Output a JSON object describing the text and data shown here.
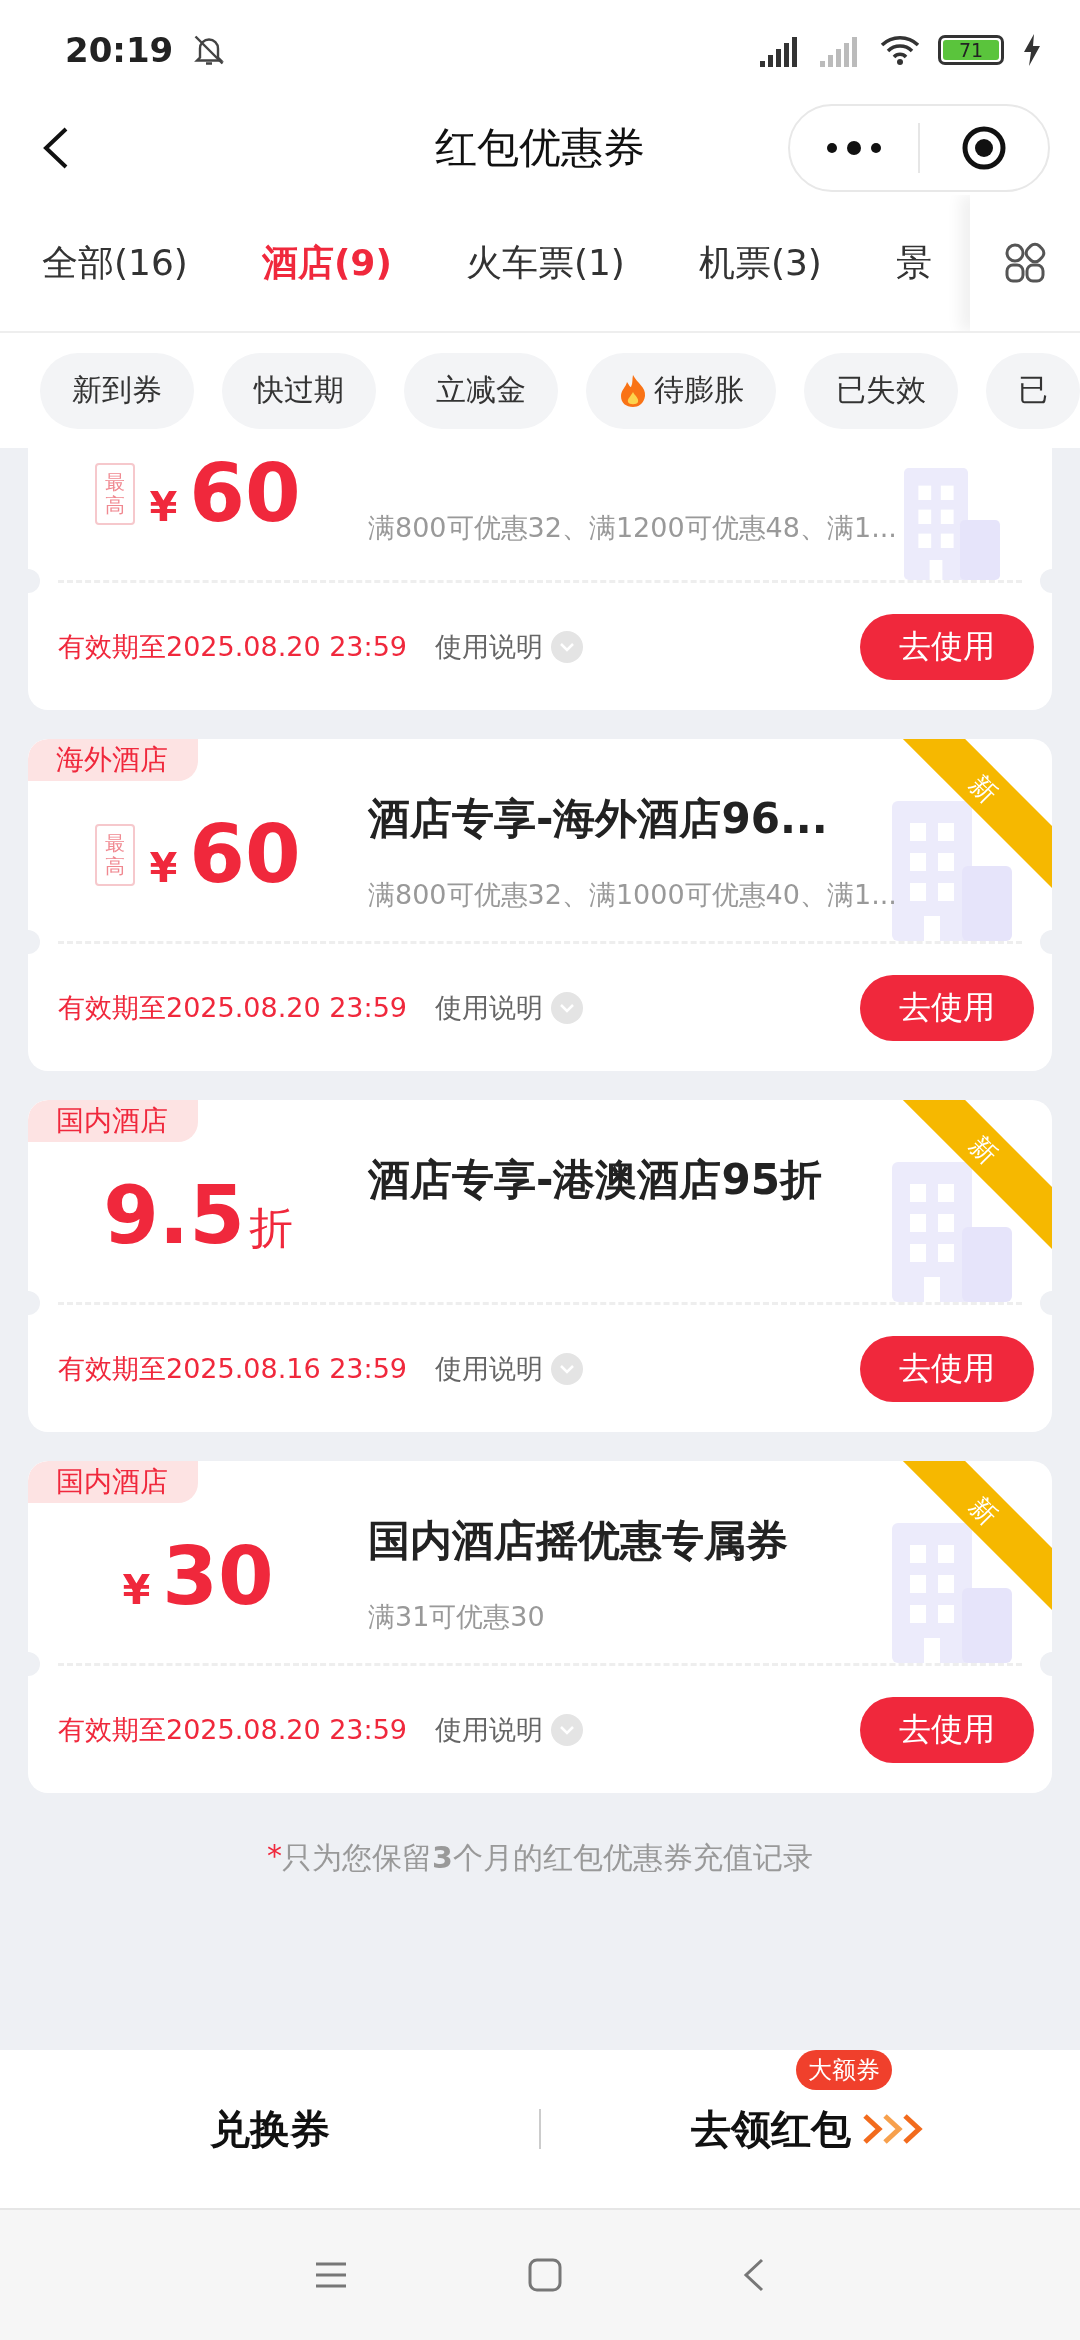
{
  "status_bar": {
    "time": "20:19",
    "battery": "71"
  },
  "header": {
    "title": "红包优惠券"
  },
  "tabs": [
    {
      "label": "全部(16)",
      "selected": false
    },
    {
      "label": "酒店(9)",
      "selected": true
    },
    {
      "label": "火车票(1)",
      "selected": false
    },
    {
      "label": "机票(3)",
      "selected": false
    },
    {
      "label": "景",
      "selected": false
    }
  ],
  "filters": [
    {
      "label": "新到券",
      "hot": false
    },
    {
      "label": "快过期",
      "hot": false
    },
    {
      "label": "立减金",
      "hot": false
    },
    {
      "label": "待膨胀",
      "hot": true
    },
    {
      "label": "已失效",
      "hot": false
    },
    {
      "label": "已",
      "hot": false
    }
  ],
  "coupons": [
    {
      "clipped": true,
      "max_label": "最高",
      "currency": "¥",
      "value": "60",
      "desc": "满800可优惠32、满1200可优惠48、满1...",
      "expiry": "有效期至2025.08.20 23:59",
      "info": "使用说明",
      "action": "去使用"
    },
    {
      "clipped": false,
      "tag": "海外酒店",
      "ribbon": "新",
      "title": "酒店专享-海外酒店96...",
      "max_label": "最高",
      "currency": "¥",
      "value": "60",
      "desc": "满800可优惠32、满1000可优惠40、满1...",
      "expiry": "有效期至2025.08.20 23:59",
      "info": "使用说明",
      "action": "去使用"
    },
    {
      "clipped": false,
      "tag": "国内酒店",
      "ribbon": "新",
      "title": "酒店专享-港澳酒店95折",
      "value": "9.5",
      "unit": "折",
      "expiry": "有效期至2025.08.16 23:59",
      "info": "使用说明",
      "action": "去使用"
    },
    {
      "clipped": false,
      "tag": "国内酒店",
      "ribbon": "新",
      "title": "国内酒店摇优惠专属券",
      "currency": "¥",
      "value": "30",
      "desc": "满31可优惠30",
      "expiry": "有效期至2025.08.20 23:59",
      "info": "使用说明",
      "action": "去使用"
    }
  ],
  "note": {
    "mark": "*",
    "text": "只为您保留**3**个月的红包优惠券充值记录"
  },
  "bottom_bar": {
    "left": "兑换券",
    "right": "去领红包",
    "badge": "大额券"
  }
}
